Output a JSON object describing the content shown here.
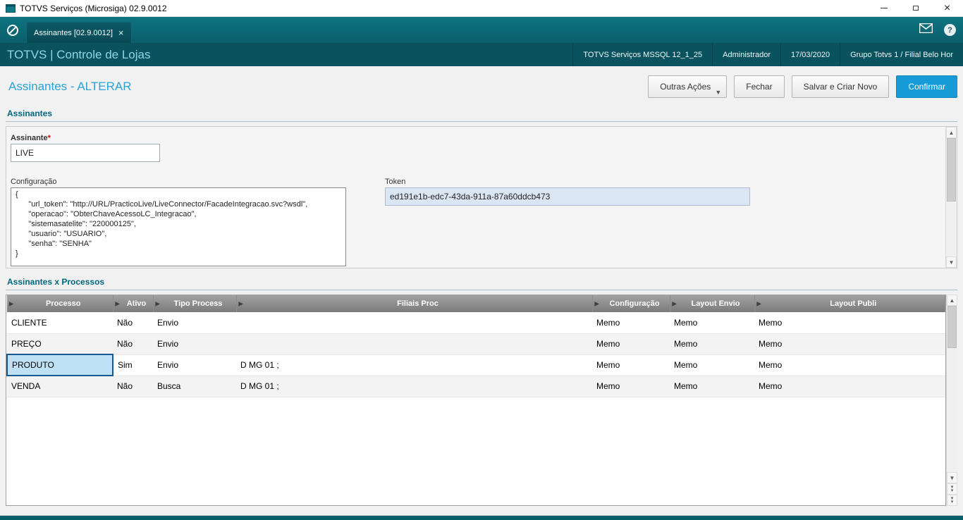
{
  "window": {
    "title": "TOTVS Serviços (Microsiga) 02.9.0012"
  },
  "tabbar": {
    "tab_label": "Assinantes [02.9.0012]",
    "tab_close": "×"
  },
  "header": {
    "brand": "TOTVS | Controle de Lojas",
    "environment": "TOTVS Serviços MSSQL 12_1_25",
    "user": "Administrador",
    "date": "17/03/2020",
    "branch": "Grupo Totvs 1 / Filial Belo Hor"
  },
  "toolbar": {
    "page_title": "Assinantes - ALTERAR",
    "other_actions": "Outras Ações",
    "close": "Fechar",
    "save_new": "Salvar e Criar Novo",
    "confirm": "Confirmar"
  },
  "form": {
    "section": "Assinantes",
    "assinante_label": "Assinante",
    "required_marker": "*",
    "assinante_value": "LIVE",
    "config_label": "Configuração",
    "config_value": "{\n      \"url_token\": \"http://URL/PracticoLive/LiveConnector/FacadeIntegracao.svc?wsdl\",\n      \"operacao\": \"ObterChaveAcessoLC_Integracao\",\n      \"sistemasatelite\": \"220000125\",\n      \"usuario\": \"USUARIO\",\n      \"senha\": \"SENHA\"\n}",
    "token_label": "Token",
    "token_value": "ed191e1b-edc7-43da-911a-87a60ddcb473"
  },
  "grid": {
    "section": "Assinantes x Processos",
    "columns": [
      "Processo",
      "Ativo",
      "Tipo Process",
      "Filiais Proc",
      "Configuração",
      "Layout Envio",
      "Layout Publi"
    ],
    "rows": [
      {
        "processo": "CLIENTE",
        "ativo": "Não",
        "tipo": "Envio",
        "filiais": "",
        "config": "Memo",
        "layout_envio": "Memo",
        "layout_publi": "Memo"
      },
      {
        "processo": "PREÇO",
        "ativo": "Não",
        "tipo": "Envio",
        "filiais": "",
        "config": "Memo",
        "layout_envio": "Memo",
        "layout_publi": "Memo"
      },
      {
        "processo": "PRODUTO",
        "ativo": "Sim",
        "tipo": "Envio",
        "filiais": "D MG 01 ;",
        "config": "Memo",
        "layout_envio": "Memo",
        "layout_publi": "Memo"
      },
      {
        "processo": "VENDA",
        "ativo": "Não",
        "tipo": "Busca",
        "filiais": "D MG 01 ;",
        "config": "Memo",
        "layout_envio": "Memo",
        "layout_publi": "Memo"
      }
    ]
  },
  "colors": {
    "teal_dark": "#0a525e",
    "teal_mid": "#0a5f6b",
    "accent_blue": "#169bd7",
    "title_blue": "#2aa3d6",
    "section_teal": "#00677f",
    "selected_cell_bg": "#bfe1f5",
    "selected_cell_border": "#17598f",
    "token_field_bg": "#dbe6f5"
  }
}
